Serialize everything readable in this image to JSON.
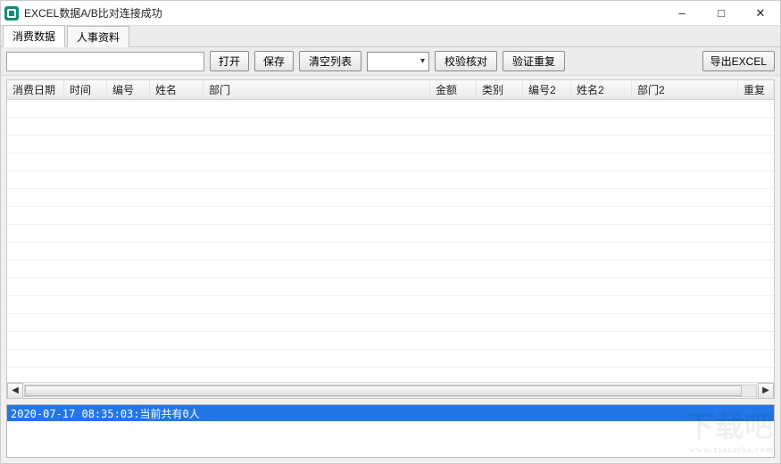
{
  "window": {
    "title": "EXCEL数据A/B比对连接成功"
  },
  "tabs": [
    {
      "label": "消费数据",
      "active": true
    },
    {
      "label": "人事资料",
      "active": false
    }
  ],
  "toolbar": {
    "path_value": "",
    "open": "打开",
    "save": "保存",
    "clear": "清空列表",
    "select_value": "",
    "verify": "校验核对",
    "validate_repeat": "验证重复",
    "export": "导出EXCEL"
  },
  "columns": [
    "消费日期",
    "时间",
    "编号",
    "姓名",
    "部门",
    "金额",
    "类别",
    "编号2",
    "姓名2",
    "部门2",
    "重复"
  ],
  "rows": [],
  "status": {
    "line": "2020-07-17 08:35:03:当前共有0人"
  }
}
